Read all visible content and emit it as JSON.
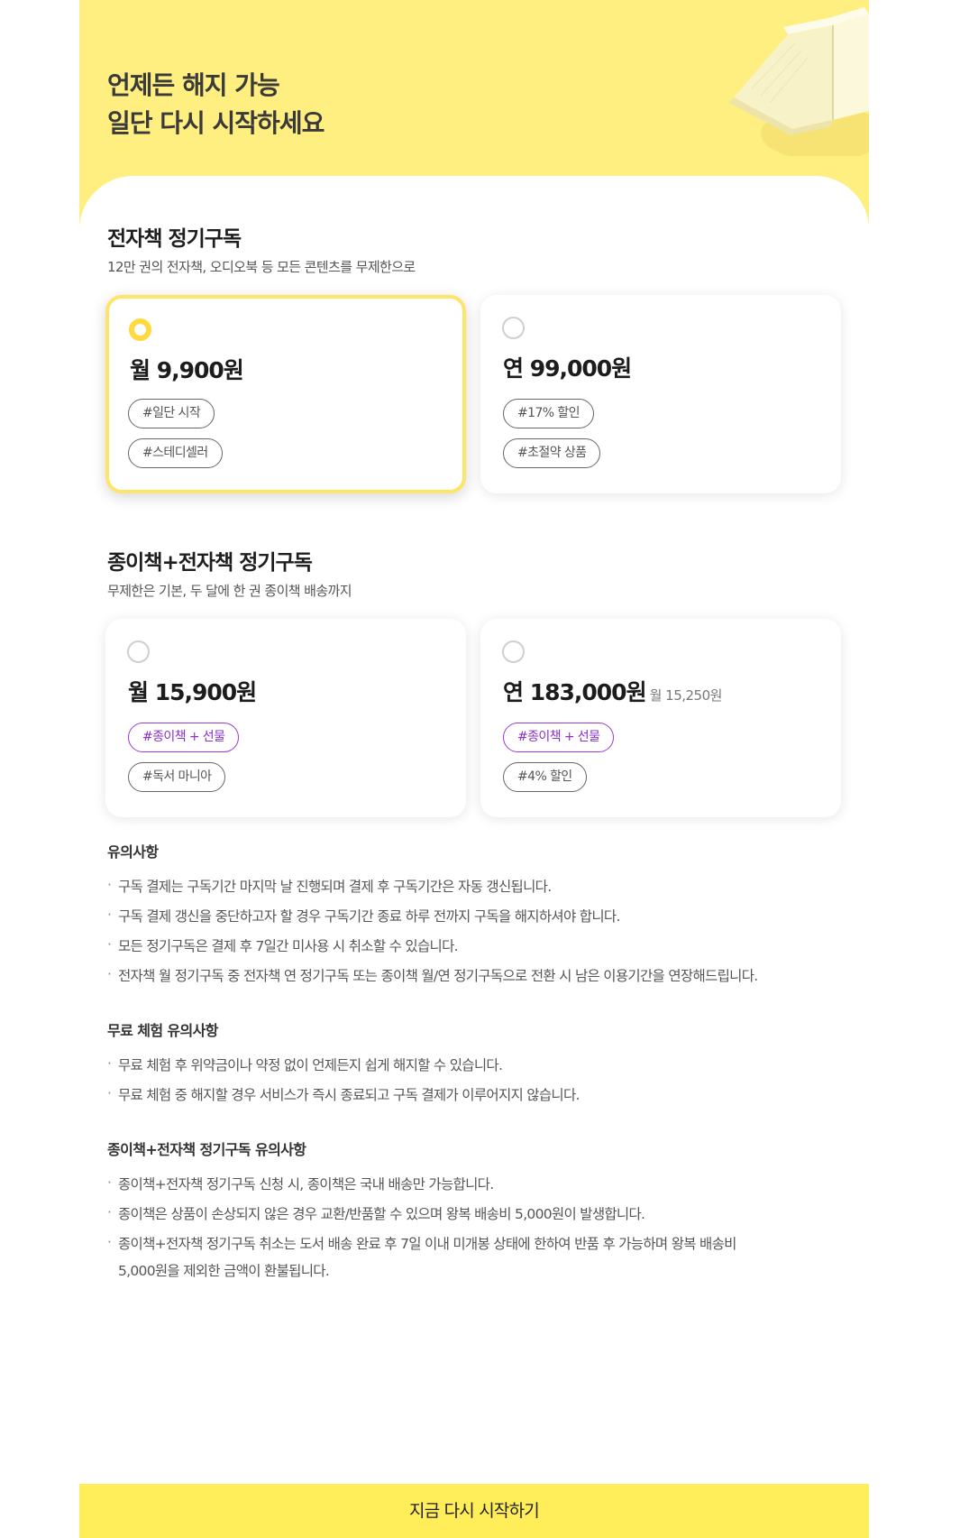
{
  "hero": {
    "line1": "언제든 해지 가능",
    "line2": "일단 다시 시작하세요",
    "illustration": "open-book-illustration"
  },
  "ebook": {
    "title": "전자책 정기구독",
    "subtitle": "12만 권의 전자책, 오디오북 등 모든 콘텐츠를 무제한으로",
    "plans": [
      {
        "price": "월 9,900원",
        "selected": true,
        "tags": [
          "#일단 시작",
          "#스테디셀러"
        ]
      },
      {
        "price": "연 99,000원",
        "selected": false,
        "tags": [
          "#17% 할인",
          "#초절약 상품"
        ]
      }
    ]
  },
  "paper": {
    "title": "종이책+전자책 정기구독",
    "subtitle": "무제한은 기본, 두 달에 한 권 종이책 배송까지",
    "plans": [
      {
        "price": "월 15,900원",
        "price_sub": "",
        "selected": false,
        "tags": [
          "#종이책 + 선물",
          "#독서 마니아"
        ]
      },
      {
        "price": "연 183,000원",
        "price_sub": "월 15,250원",
        "selected": false,
        "tags": [
          "#종이책 + 선물",
          "#4% 할인"
        ]
      }
    ]
  },
  "notes": [
    {
      "title": "유의사항",
      "items": [
        "구독 결제는 구독기간 마지막 날 진행되며 결제 후 구독기간은 자동 갱신됩니다.",
        "구독 결제 갱신을 중단하고자 할 경우 구독기간 종료 하루 전까지 구독을 해지하셔야 합니다.",
        "모든 정기구독은 결제 후 7일간 미사용 시 취소할 수 있습니다.",
        "전자책 월 정기구독 중 전자책 연 정기구독 또는 종이책 월/연 정기구독으로 전환 시 남은 이용기간을 연장해드립니다."
      ]
    },
    {
      "title": "무료 체험 유의사항",
      "items": [
        "무료 체험 후 위약금이나 약정 없이 언제든지 쉽게 해지할 수 있습니다.",
        "무료 체험 중 해지할 경우 서비스가 즉시 종료되고 구독 결제가 이루어지지 않습니다."
      ]
    },
    {
      "title": "종이책+전자책 정기구독 유의사항",
      "items": [
        "종이책+전자책 정기구독 신청 시, 종이책은 국내 배송만 가능합니다.",
        "종이책은 상품이 손상되지 않은 경우 교환/반품할 수 있으며 왕복 배송비 5,000원이 발생합니다.",
        "종이책+전자책 정기구독 취소는 도서 배송 완료 후 7일 이내 미개봉 상태에 한하여 반품 후 가능하며 왕복 배송비",
        "5,000원을 제외한 금액이 환불됩니다."
      ]
    }
  ],
  "cta": {
    "label": "지금 다시 시작하기"
  },
  "colors": {
    "hero_bg": "#ffee80",
    "selected_border": "#ffe46a",
    "radio_on": "#ffd93d",
    "tag_purple": "#9b3ad6",
    "cta_bg": "#ffee5a"
  }
}
